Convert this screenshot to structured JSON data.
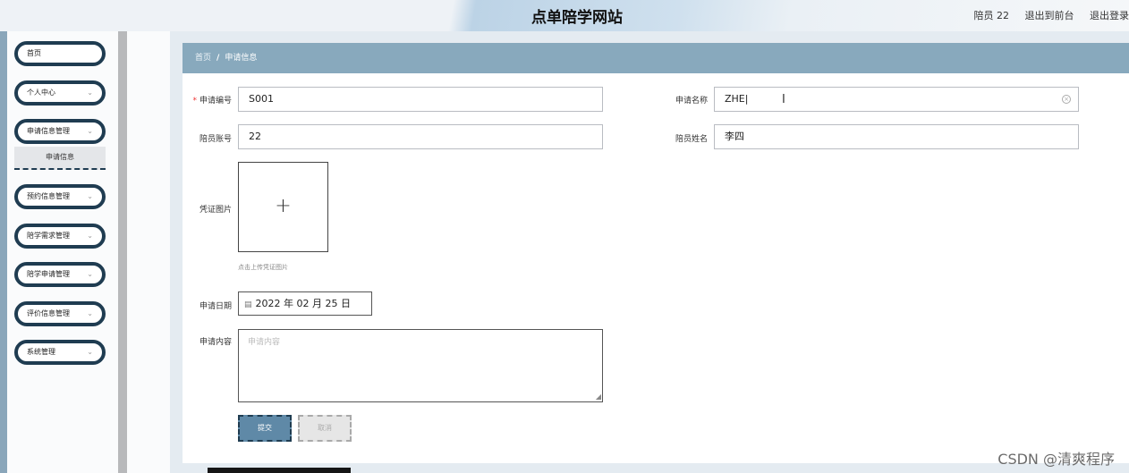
{
  "header": {
    "site_title": "点单陪学网站",
    "user_label": "陪员 22",
    "back_link": "退出到前台",
    "logout_link": "退出登录"
  },
  "sidebar": {
    "items": [
      {
        "label": "首页",
        "has_chevron": false
      },
      {
        "label": "个人中心",
        "chevron": "⌄"
      },
      {
        "label": "申请信息管理",
        "chevron": "⌄"
      },
      {
        "label": "预约信息管理",
        "chevron": "⌄"
      },
      {
        "label": "陪学需求管理",
        "chevron": "⌄"
      },
      {
        "label": "陪学申请管理",
        "chevron": "⌄"
      },
      {
        "label": "评价信息管理",
        "chevron": "⌄"
      },
      {
        "label": "系统管理",
        "chevron": "⌄"
      }
    ],
    "active_sub_item": "申请信息"
  },
  "breadcrumb": {
    "home": "首页",
    "separator": "/",
    "current": "申请信息"
  },
  "form": {
    "apply_no": {
      "label": "申请编号",
      "required_mark": "*",
      "value": "S001"
    },
    "apply_name": {
      "label": "申请名称",
      "value": "ZHE|"
    },
    "companion_account": {
      "label": "陪员账号",
      "value": "22"
    },
    "companion_name": {
      "label": "陪员姓名",
      "value": "李四"
    },
    "proof_image": {
      "label": "凭证图片",
      "plus": "+",
      "hint": "点击上传凭证图片"
    },
    "apply_date": {
      "label": "申请日期",
      "value": "2022 年 02 月 25 日",
      "icon": "calendar-icon"
    },
    "apply_content": {
      "label": "申请内容",
      "placeholder": "申请内容"
    },
    "submit_label": "提交",
    "cancel_label": "取消"
  },
  "watermark": "CSDN @清爽程序",
  "colors": {
    "accent": "#88a9bd",
    "menu_border": "#1f3c51",
    "submit_bg": "#5f89a7",
    "required": "#e33333"
  }
}
